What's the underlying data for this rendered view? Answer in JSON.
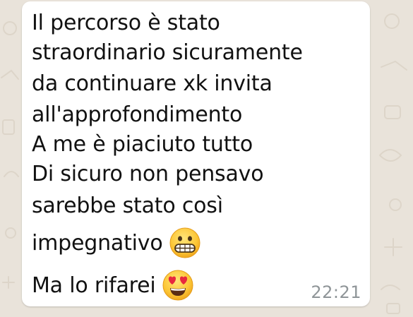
{
  "message": {
    "lines": [
      "Il percorso è stato",
      "straordinario sicuramente",
      "da continuare xk invita",
      "all'approfondimento",
      "A me è piaciuto tutto",
      "Di sicuro non pensavo",
      "sarebbe stato così",
      "impegnativo",
      "Ma lo rifarei"
    ],
    "emojis": [
      "grimacing-face-emoji",
      "heart-eyes-emoji"
    ],
    "time": "22:21"
  },
  "colors": {
    "bubble": "#ffffff",
    "wallpaper": "#e9e3da",
    "timestamp": "#8f9598",
    "text": "#111111"
  }
}
